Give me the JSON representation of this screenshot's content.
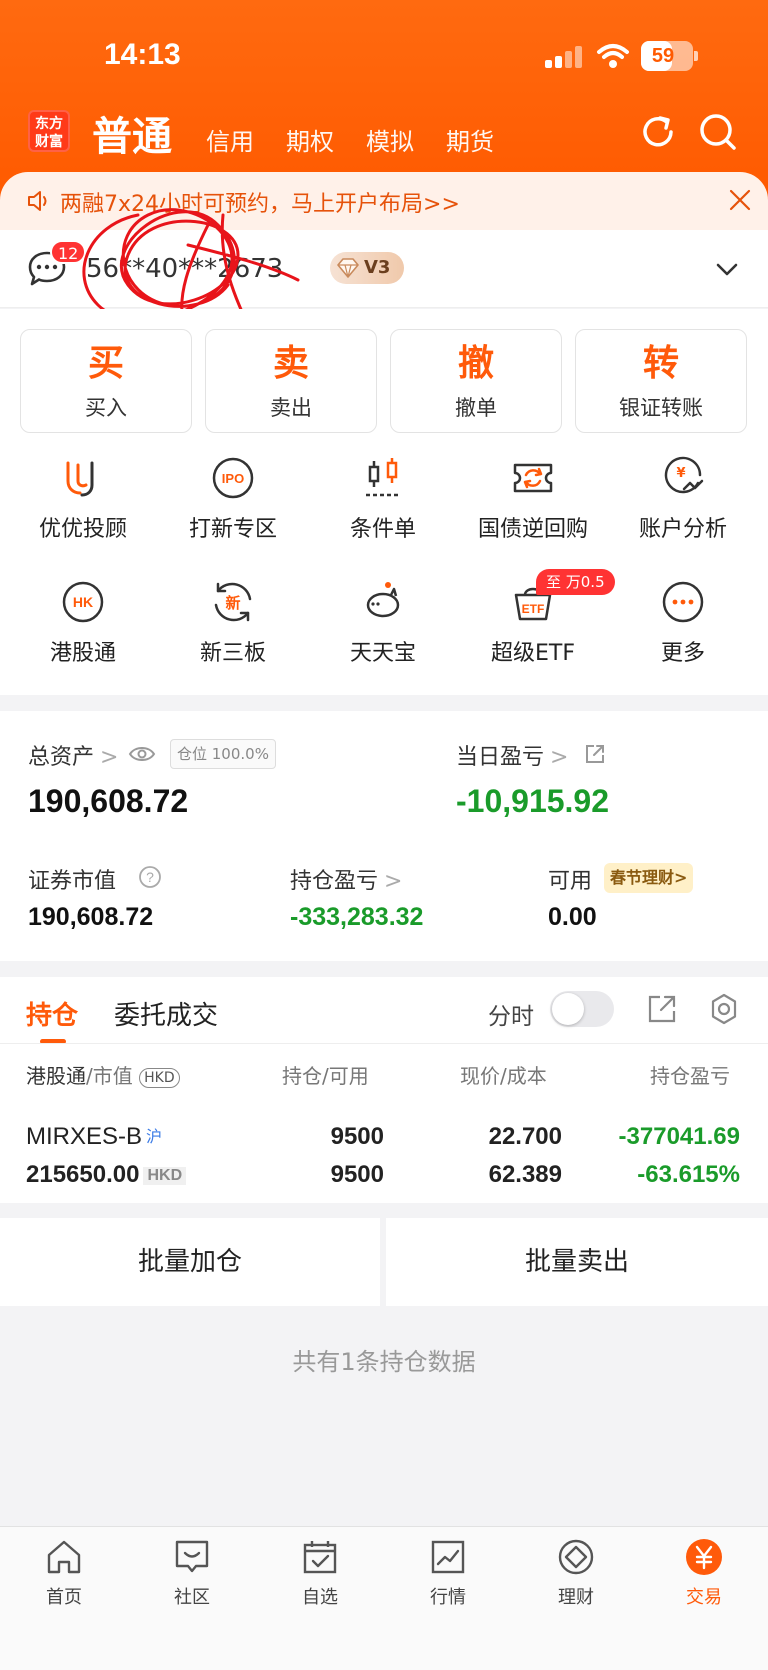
{
  "status_bar": {
    "time": "14:13",
    "battery": "59",
    "battery_level": 0.59
  },
  "header": {
    "logo_text": "东方\n财富",
    "active_tab": "普通",
    "tabs": [
      "信用",
      "期权",
      "模拟",
      "期货"
    ]
  },
  "banner": {
    "text": "两融7x24小时可预约，马上开户布局>>"
  },
  "account": {
    "message_count": "12",
    "account_masked": "56**40***2673",
    "vip_level": "V3"
  },
  "actions": [
    {
      "big": "买",
      "label": "买入"
    },
    {
      "big": "卖",
      "label": "卖出"
    },
    {
      "big": "撤",
      "label": "撤单"
    },
    {
      "big": "转",
      "label": "银证转账"
    }
  ],
  "features_row1": [
    "优优投顾",
    "打新专区",
    "条件单",
    "国债逆回购",
    "账户分析"
  ],
  "features_row2": [
    "港股通",
    "新三板",
    "天天宝",
    "超级ETF",
    "更多"
  ],
  "etf_badge": "至  万0.5",
  "assets": {
    "total_label": "总资产",
    "position_tag": "仓位 100.0%",
    "total_value": "190,608.72",
    "daily_pl_label": "当日盈亏",
    "daily_pl_value": "-10,915.92",
    "market_value_label": "证券市值",
    "market_value": "190,608.72",
    "holding_pl_label": "持仓盈亏",
    "holding_pl": "-333,283.32",
    "available_label": "可用",
    "available_tag": "春节理财>",
    "available": "0.00"
  },
  "holdings": {
    "tab_active": "持仓",
    "tab_other": "委托成交",
    "fenshi_label": "分时",
    "fenshi_on": false,
    "headers": {
      "col1_main": "港股通",
      "col1_sub": "/市值",
      "col1_currency": "HKD",
      "col2_main": "持仓",
      "col2_sub": "/可用",
      "col3_main": "现价",
      "col3_sub": "/成本",
      "col4": "持仓盈亏"
    },
    "rows": [
      {
        "name": "MIRXES-B",
        "exchange": "沪",
        "market_value": "215650.00",
        "currency": "HKD",
        "quantity": "9500",
        "available": "9500",
        "price": "22.700",
        "cost": "62.389",
        "pl": "-377041.69",
        "pl_pct": "-63.615%"
      }
    ]
  },
  "batch": {
    "add": "批量加仓",
    "sell": "批量卖出"
  },
  "footnote": "共有1条持仓数据",
  "tabbar": [
    "首页",
    "社区",
    "自选",
    "行情",
    "理财",
    "交易"
  ],
  "colors": {
    "brand": "#ff5a00",
    "accent": "#ff5a0a",
    "loss": "#1a9b2a"
  }
}
